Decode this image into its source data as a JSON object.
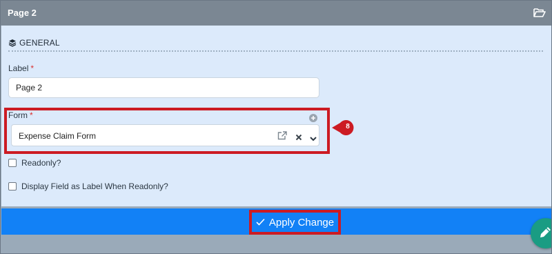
{
  "header": {
    "title": "Page 2",
    "folder_icon": "folder-open-icon"
  },
  "section": {
    "title": "GENERAL",
    "icon": "layers-icon"
  },
  "label_field": {
    "label": "Label",
    "required_mark": "*",
    "value": "Page 2"
  },
  "form_field": {
    "label": "Form",
    "required_mark": "*",
    "value": "Expense Claim Form",
    "icons": [
      "plus-circle-icon",
      "external-link-icon",
      "clear-icon",
      "chevron-down-icon"
    ]
  },
  "checkboxes": [
    {
      "label": "Readonly?",
      "checked": false
    },
    {
      "label": "Display Field as Label When Readonly?",
      "checked": false
    }
  ],
  "callout": {
    "number": "8",
    "color": "#cc1b23"
  },
  "apply": {
    "label": "Apply Change",
    "icon": "check-icon"
  },
  "fab": {
    "icon": "pencil-icon",
    "color": "#1a9c83"
  },
  "colors": {
    "header": "#7b8793",
    "panel": "#dceafb",
    "primary": "#1281f6",
    "highlight": "#cc1b23"
  }
}
